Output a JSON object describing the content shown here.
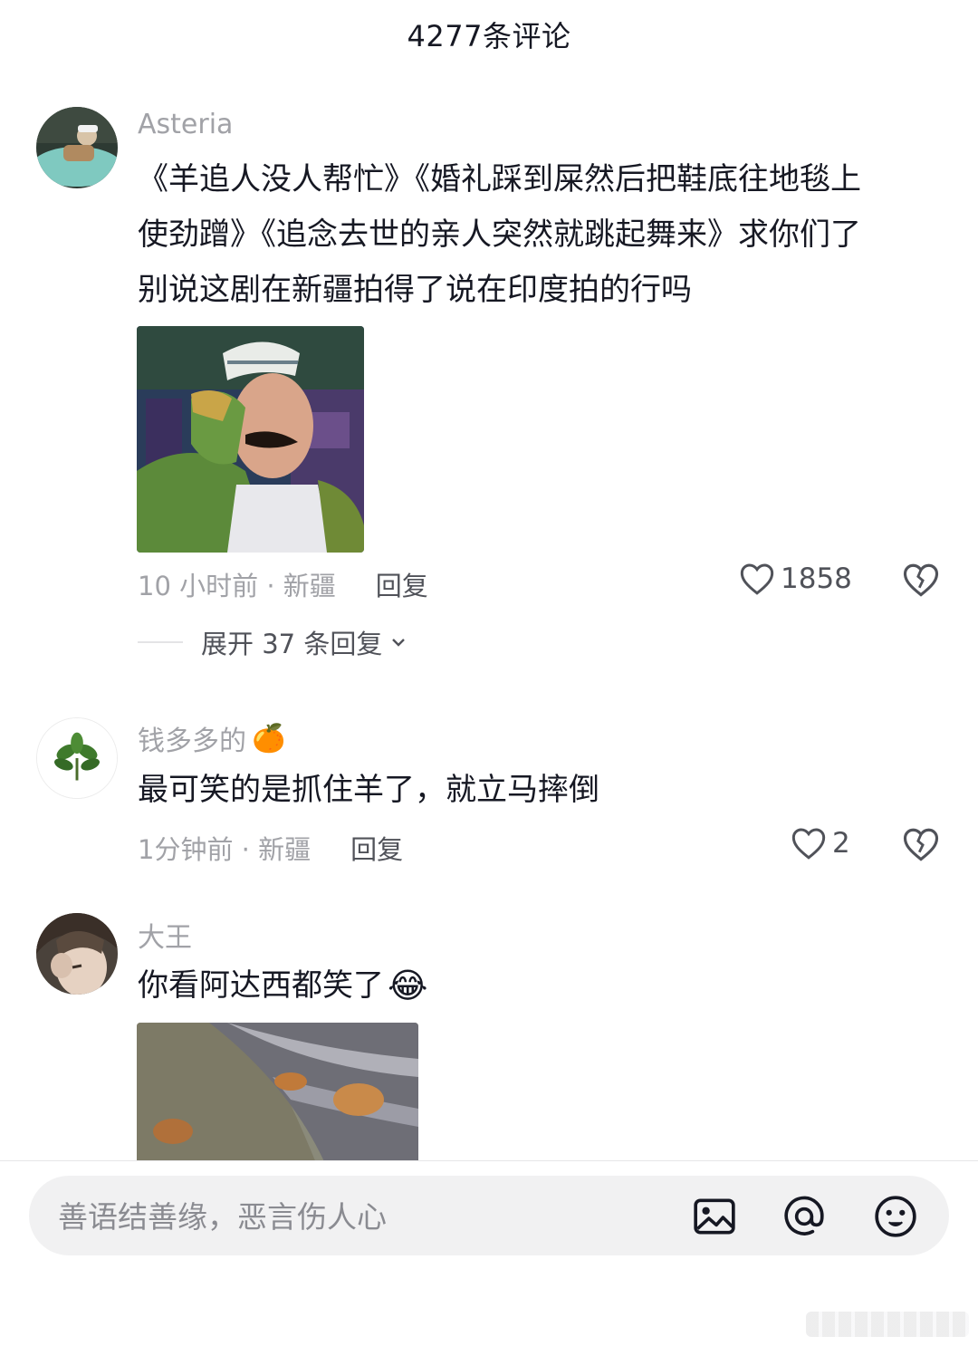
{
  "header": {
    "title": "4277条评论"
  },
  "comments": [
    {
      "author": "Asteria",
      "text_line1": "《羊追人没人帮忙》《婚礼踩到屎然后把鞋底往地毯上",
      "text_line2": "使劲蹭》《追念去世的亲人突然就跳起舞来》求你们了",
      "text_line3": "别说这剧在新疆拍得了说在印度拍的行吗",
      "time_location": "10 小时前 · 新疆",
      "reply_label": "回复",
      "likes": "1858",
      "expand_label": "展开 37 条回复"
    },
    {
      "author": "钱多多的",
      "author_emoji": "🍊",
      "text": "最可笑的是抓住羊了，就立马摔倒",
      "time_location": "1分钟前 · 新疆",
      "reply_label": "回复",
      "likes": "2"
    },
    {
      "author": "大王",
      "text": "你看阿达西都笑了",
      "text_emoji": "😂"
    }
  ],
  "input": {
    "placeholder": "善语结善缘，恶言伤人心"
  },
  "icons": {
    "like": "heart-outline-icon",
    "dislike": "broken-heart-icon",
    "expand": "chevron-down-icon",
    "image": "image-icon",
    "mention": "at-icon",
    "emoji": "smiley-icon"
  },
  "colors": {
    "text": "#161823",
    "secondary": "#a1a2a7",
    "action": "#505259",
    "input_bg": "#f1f1f2"
  }
}
